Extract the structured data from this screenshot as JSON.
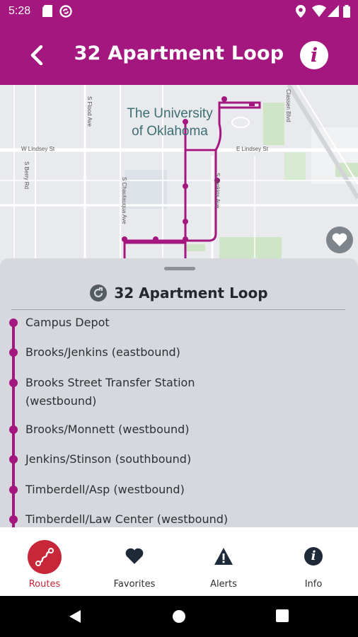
{
  "status_bar": {
    "time": "5:28",
    "icons": [
      "sd-card-icon",
      "sync-icon",
      "location-icon",
      "wifi-icon",
      "signal-icon",
      "battery-icon"
    ]
  },
  "app_bar": {
    "title": "32 Apartment Loop",
    "back_icon": "chevron-left-icon",
    "info_icon": "info-icon",
    "info_glyph": "i"
  },
  "map": {
    "campus_label_line1": "The University",
    "campus_label_line2": "of Oklahoma",
    "streets": {
      "s_flood": "S Flood Ave",
      "w_lindsey": "W Lindsey St",
      "e_lindsey": "E Lindsey St",
      "s_berry": "S Berry Rd",
      "s_chautauqua": "S Chautauqua Ave",
      "s_jenkins": "S Jenkins Ave",
      "classen": "Classen Blvd"
    },
    "favorite_icon": "heart-icon",
    "route_color": "#a3177e"
  },
  "sheet": {
    "title": "32 Apartment Loop",
    "route_icon": "route-refresh-icon",
    "stops": [
      {
        "name": "Campus Depot"
      },
      {
        "name": "Brooks/Jenkins (eastbound)"
      },
      {
        "name": "Brooks Street Transfer Station (westbound)"
      },
      {
        "name": "Brooks/Monnett (westbound)"
      },
      {
        "name": "Jenkins/Stinson (southbound)"
      },
      {
        "name": "Timberdell/Asp (westbound)"
      },
      {
        "name": "Timberdell/Law Center (westbound)"
      }
    ]
  },
  "bottom_nav": {
    "items": [
      {
        "label": "Routes",
        "icon": "routes-icon",
        "active": true
      },
      {
        "label": "Favorites",
        "icon": "heart-icon",
        "active": false
      },
      {
        "label": "Alerts",
        "icon": "alert-triangle-icon",
        "active": false
      },
      {
        "label": "Info",
        "icon": "info-icon",
        "active": false
      }
    ]
  },
  "colors": {
    "brand": "#a3177e",
    "active_nav": "#c8273a",
    "sheet_bg": "#d7d8dd"
  }
}
